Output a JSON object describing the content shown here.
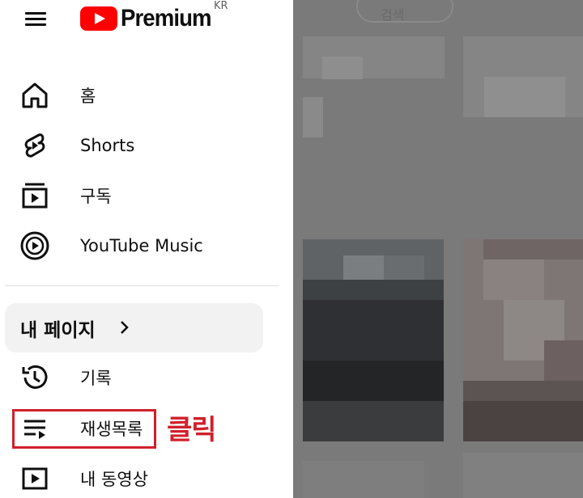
{
  "header": {
    "logo_text": "Premium",
    "region": "KR",
    "search_hint": "검색"
  },
  "nav": {
    "primary": [
      {
        "label": "홈",
        "icon": "home-icon"
      },
      {
        "label": "Shorts",
        "icon": "shorts-icon"
      },
      {
        "label": "구독",
        "icon": "subscriptions-icon"
      },
      {
        "label": "YouTube Music",
        "icon": "youtube-music-icon"
      }
    ],
    "my_page": {
      "label": "내 페이지",
      "icon": "chevron-right-icon"
    },
    "secondary": [
      {
        "label": "기록",
        "icon": "history-icon"
      },
      {
        "label": "재생목록",
        "icon": "playlists-icon"
      },
      {
        "label": "내 동영상",
        "icon": "your-videos-icon"
      }
    ]
  },
  "annotation": {
    "text": "클릭",
    "color": "#d0202c"
  },
  "colors": {
    "brand_red": "#ff0000",
    "overlay": "#7a7a7a",
    "pill_bg": "#f2f2f2"
  }
}
